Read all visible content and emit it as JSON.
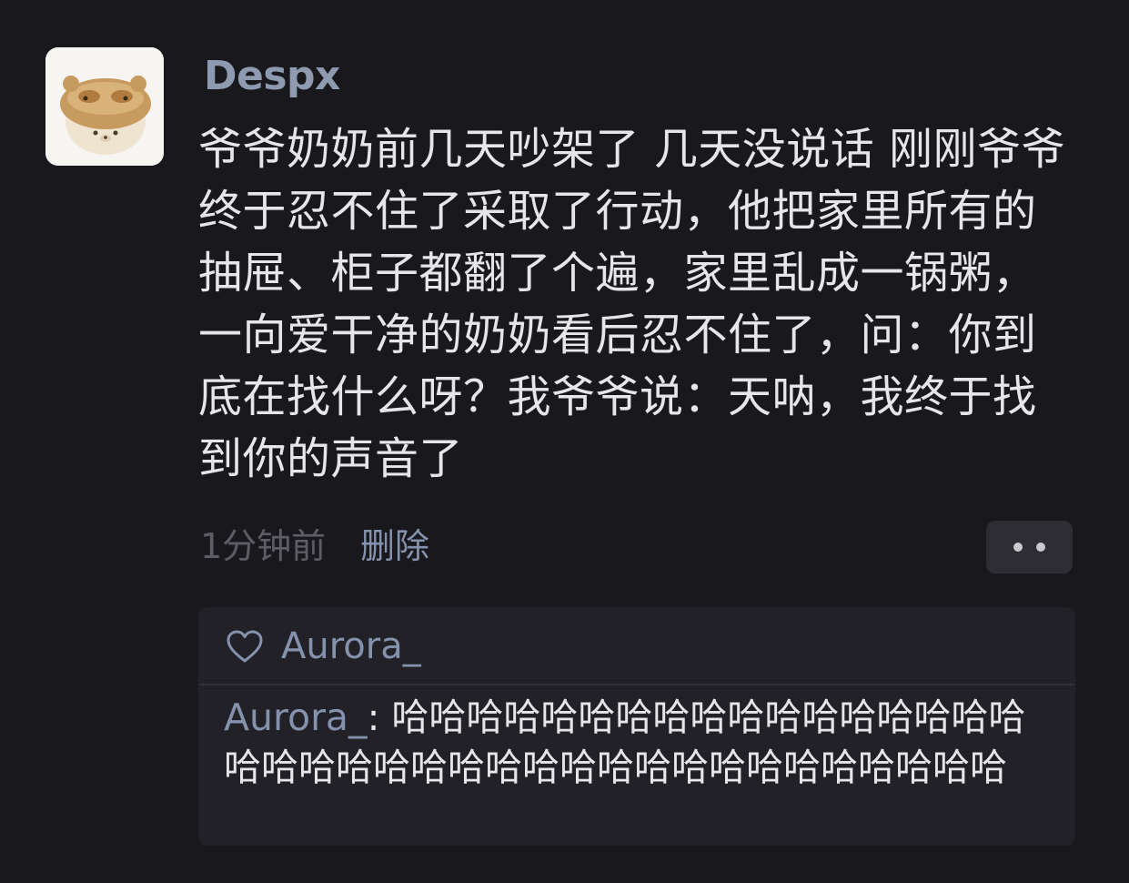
{
  "post": {
    "username": "Despx",
    "text": "爷爷奶奶前几天吵架了 几天没说话 刚刚爷爷终于忍不住了采取了行动，他把家里所有的抽屉、柜子都翻了个遍，家里乱成一锅粥，一向爱干净的奶奶看后忍不住了，问：你到底在找什么呀？我爷爷说：天呐，我终于找到你的声音了",
    "time": "1分钟前",
    "delete_label": "删除",
    "more_icon": "more-dots-icon"
  },
  "likes": {
    "icon": "heart-icon",
    "names": "Aurora_"
  },
  "comment": {
    "author": "Aurora_",
    "separator": ": ",
    "text": "哈哈哈哈哈哈哈哈哈哈哈哈哈哈哈哈哈哈哈哈哈哈哈哈哈哈哈哈哈哈哈哈哈哈哈哈哈哈"
  },
  "colors": {
    "background": "#19181d",
    "link": "#8592ad",
    "text": "#e6e6e8",
    "muted": "#5e5d66"
  }
}
